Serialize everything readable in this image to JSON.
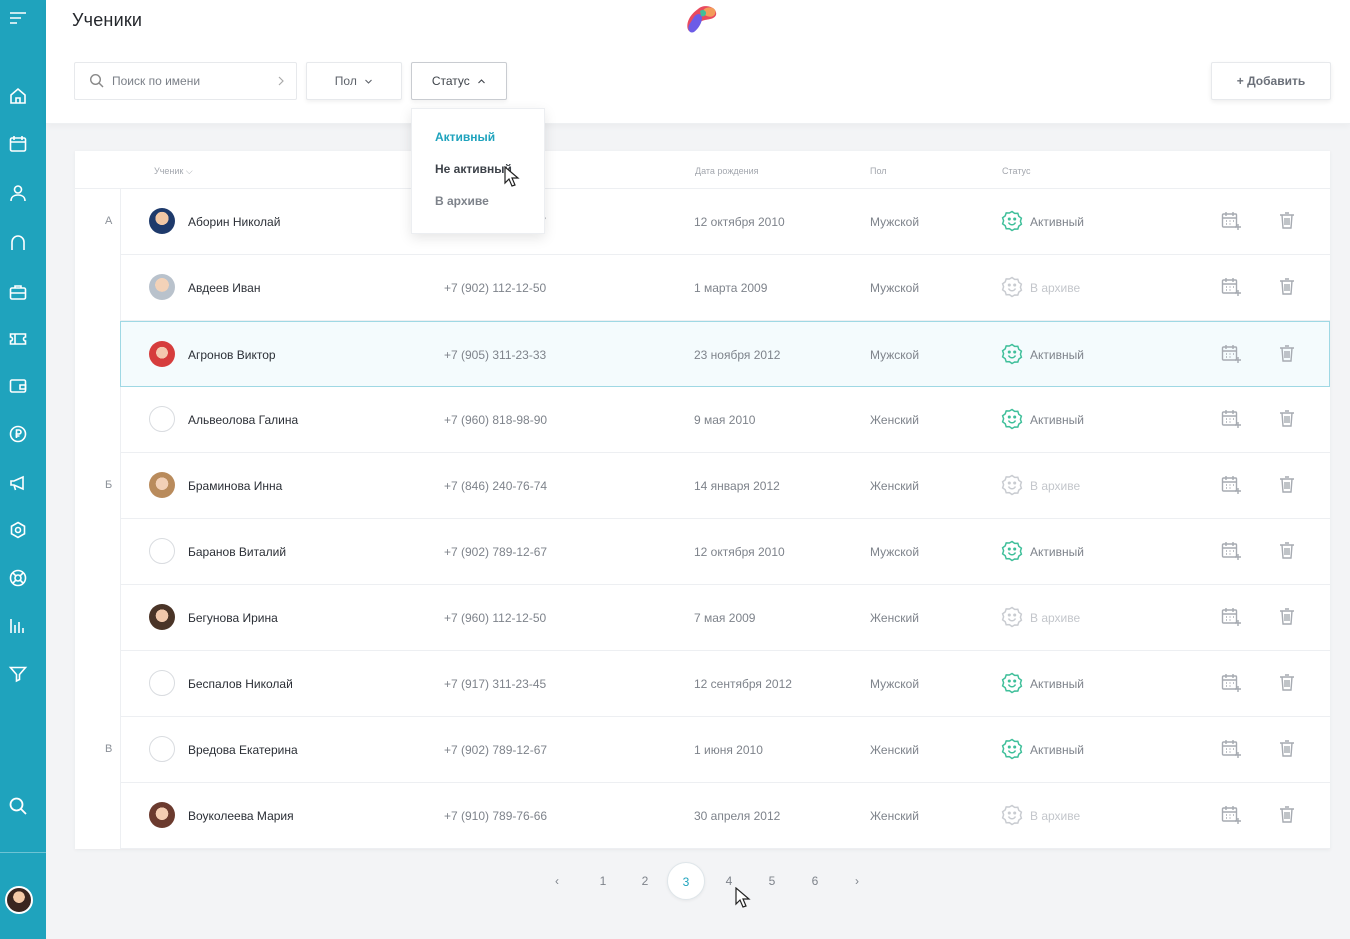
{
  "page": {
    "title": "Ученики"
  },
  "colors": {
    "accent": "#1fa3bd",
    "active_status": "#3fbf9a",
    "archived_status": "#c9ccd1"
  },
  "sidebar": {
    "icons": [
      "menu-icon",
      "home-icon",
      "calendar-icon",
      "user-icon",
      "headset-icon",
      "briefcase-icon",
      "ticket-icon",
      "wallet-icon",
      "currency-icon",
      "megaphone-icon",
      "settings-icon",
      "support-icon",
      "chart-icon",
      "filter-icon",
      "search-icon"
    ]
  },
  "search": {
    "placeholder": "Поиск по имени"
  },
  "filters": {
    "gender_label": "Пол",
    "status_label": "Статус"
  },
  "add_button": {
    "label": "+ Добавить"
  },
  "status_dropdown": {
    "options": [
      "Активный",
      "Не активный",
      "В архиве"
    ]
  },
  "table": {
    "headers": {
      "student": "Ученик",
      "birth": "Дата рождения",
      "gender": "Пол",
      "status": "Статус"
    },
    "letters": [
      "А",
      "Б",
      "В"
    ],
    "rows": [
      {
        "name": "Аборин Николай",
        "phone": "+7 (902) 112-12-57",
        "birth": "12 октября 2010",
        "gender": "Мужской",
        "status": "Активный"
      },
      {
        "name": "Авдеев Иван",
        "phone": "+7 (902) 112-12-50",
        "birth": "1 марта 2009",
        "gender": "Мужской",
        "status": "В архиве"
      },
      {
        "name": "Агронов Виктор",
        "phone": "+7 (905) 311-23-33",
        "birth": "23 ноября 2012",
        "gender": "Мужской",
        "status": "Активный"
      },
      {
        "name": "Альвеолова Галина",
        "phone": "+7 (960) 818-98-90",
        "birth": "9 мая 2010",
        "gender": "Женский",
        "status": "Активный"
      },
      {
        "name": "Браминова Инна",
        "phone": "+7 (846) 240-76-74",
        "birth": "14 января 2012",
        "gender": "Женский",
        "status": "В архиве"
      },
      {
        "name": "Баранов Виталий",
        "phone": "+7 (902) 789-12-67",
        "birth": "12 октября 2010",
        "gender": "Мужской",
        "status": "Активный"
      },
      {
        "name": "Бегунова Ирина",
        "phone": "+7 (960) 112-12-50",
        "birth": "7 мая 2009",
        "gender": "Женский",
        "status": "В архиве"
      },
      {
        "name": "Беспалов Николай",
        "phone": "+7 (917) 311-23-45",
        "birth": "12 сентября 2012",
        "gender": "Мужской",
        "status": "Активный"
      },
      {
        "name": "Вредова Екатерина",
        "phone": "+7 (902) 789-12-67",
        "birth": "1 июня 2010",
        "gender": "Женский",
        "status": "Активный"
      },
      {
        "name": "Воуколеева Мария",
        "phone": "+7 (910) 789-76-66",
        "birth": "30 апреля 2012",
        "gender": "Женский",
        "status": "В архиве"
      }
    ]
  },
  "pagination": {
    "prev": "‹",
    "next": "›",
    "pages": [
      "1",
      "2",
      "3",
      "4",
      "5",
      "6"
    ],
    "current": "3"
  }
}
